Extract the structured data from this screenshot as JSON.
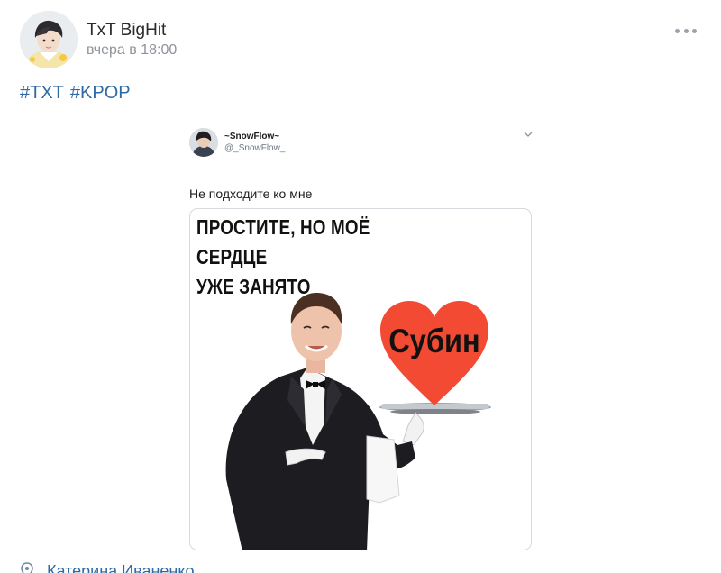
{
  "post": {
    "author_name": "TxT BigHit",
    "timestamp": "вчера в 18:00",
    "hashtags": [
      "#TXT",
      "#KPOP"
    ]
  },
  "tweet": {
    "display_name": "~SnowFlow~",
    "handle": "@_SnowFlow_",
    "text": "Не подходите ко мне",
    "meme": {
      "caption_lines": [
        "ПРОСТИТЕ, НО МОЁ",
        "СЕРДЦЕ",
        "УЖЕ ЗАНЯТО"
      ],
      "heart_label": "Субин",
      "heart_color": "#f24a33"
    }
  },
  "footer": {
    "text": "Катерина Иваненко"
  },
  "colors": {
    "link": "#2f6aa6",
    "muted": "#8e9399",
    "dots": "#9aa3ad"
  },
  "icons": [
    "more-icon",
    "chevron-down-icon",
    "heart-icon",
    "location-icon"
  ]
}
